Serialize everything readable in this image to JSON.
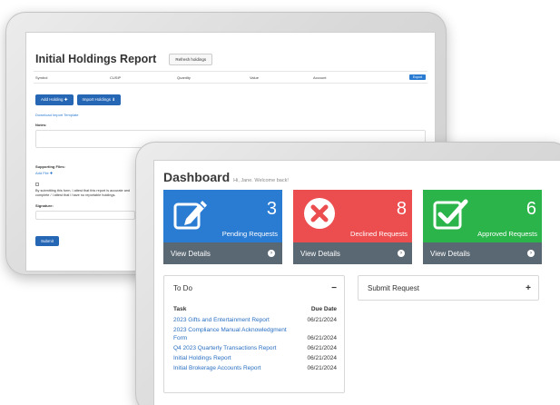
{
  "holdings": {
    "title": "Initial Holdings Report",
    "refresh_label": "Refresh holdings",
    "columns": [
      "Symbol",
      "CUSIP",
      "Quantity",
      "Value",
      "Account"
    ],
    "export_label": "Export",
    "add_holding_label": "Add Holding ✚",
    "import_holdings_label": "Import Holdings ⬇",
    "download_template": "Download Import Template",
    "notes_label": "Notes:",
    "supporting_files_label": "Supporting Files:",
    "add_file_label": "Add File ✚",
    "attestation": "By submitting this form, I attest that this report is accurate and complete / I attest that I have no reportable holdings.",
    "signature_label": "Signature:",
    "submit_label": "Submit"
  },
  "dashboard": {
    "title": "Dashboard",
    "greeting": "Hi, Jane. Welcome back!",
    "cards": [
      {
        "count": "3",
        "label": "Pending Requests",
        "footer": "View Details",
        "color": "#2a7bd2",
        "icon": "pencil-square-icon"
      },
      {
        "count": "8",
        "label": "Declined Requests",
        "footer": "View Details",
        "color": "#ec4d4f",
        "icon": "x-circle-icon"
      },
      {
        "count": "6",
        "label": "Approved Requests",
        "footer": "View Details",
        "color": "#2bb44a",
        "icon": "check-square-icon"
      }
    ],
    "todo": {
      "title": "To Do",
      "col_task": "Task",
      "col_due": "Due Date",
      "items": [
        {
          "task": "2023 Gifts and Entertainment Report",
          "due": "06/21/2024"
        },
        {
          "task": "2023 Compliance Manual Acknowledgment Form",
          "due": "06/21/2024"
        },
        {
          "task": "Q4 2023 Quarterly Transactions Report",
          "due": "06/21/2024"
        },
        {
          "task": "Initial Holdings Report",
          "due": "06/21/2024"
        },
        {
          "task": "Initial Brokerage Accounts Report",
          "due": "06/21/2024"
        }
      ]
    },
    "submit_request": {
      "title": "Submit Request"
    }
  }
}
